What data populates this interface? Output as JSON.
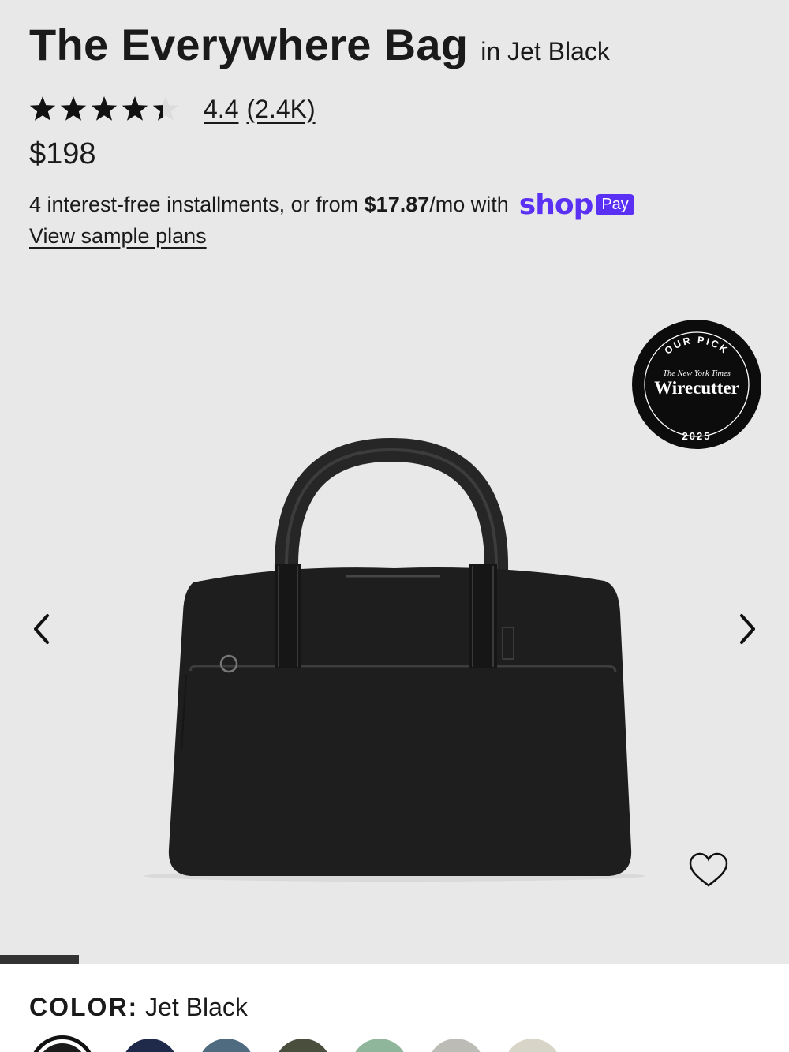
{
  "product": {
    "title": "The Everywhere Bag",
    "variant": "in Jet Black",
    "rating": 4.4,
    "rating_text": "4.4",
    "review_count": "(2.4K)",
    "price": "$198"
  },
  "financing": {
    "prefix": "4 interest-free installments, or from ",
    "amount": "$17.87",
    "suffix": "/mo with",
    "brand_word": "shop",
    "badge": "Pay",
    "sample_link": "View sample plans",
    "brand_color": "#5a31f4"
  },
  "badge": {
    "top": "OUR PICK",
    "publisher": "The New York Times",
    "name": "Wirecutter",
    "year": "2025"
  },
  "gallery": {
    "prev_icon": "chevron-left-icon",
    "next_icon": "chevron-right-icon",
    "wishlist_icon": "heart-outline-icon",
    "progress": 0.1
  },
  "color": {
    "label": "COLOR:",
    "value": "Jet Black",
    "swatches": [
      {
        "name": "Jet Black",
        "hex": "#1c1c1c",
        "selected": true
      },
      {
        "name": "",
        "hex": "#1f2a4a"
      },
      {
        "name": "",
        "hex": "#4f6b80"
      },
      {
        "name": "",
        "hex": "#4a4e3c"
      },
      {
        "name": "",
        "hex": "#8fb59a"
      },
      {
        "name": "",
        "hex": "#bdbbb5"
      },
      {
        "name": "",
        "hex": "#d8d5c8"
      }
    ]
  }
}
